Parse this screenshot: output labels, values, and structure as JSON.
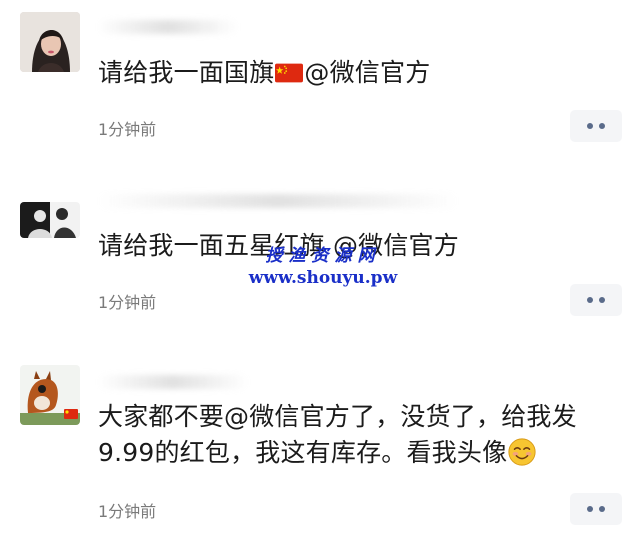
{
  "comments": [
    {
      "text_before": "请给我一面国旗",
      "text_after": "@微信官方",
      "time": "1分钟前",
      "avatar_icon": "avatar-woman-photo"
    },
    {
      "text": "请给我一面五星红旗 @微信官方",
      "time": "1分钟前",
      "avatar_icon": "avatar-silhouette-photo"
    },
    {
      "text_line1": "大家都不要@微信官方了，没货了，给我发",
      "text_line2": "9.99的红包，我这有库存。看我头像",
      "time": "1分钟前",
      "avatar_icon": "avatar-squirrel-photo"
    }
  ],
  "watermark": {
    "cn": "授渔资源网",
    "url": "www.shouyu.pw"
  },
  "colors": {
    "accent_dots": "#5a6b8a",
    "watermark": "#1a2fc8",
    "flag_red": "#de2910",
    "flag_yellow": "#ffde00"
  }
}
